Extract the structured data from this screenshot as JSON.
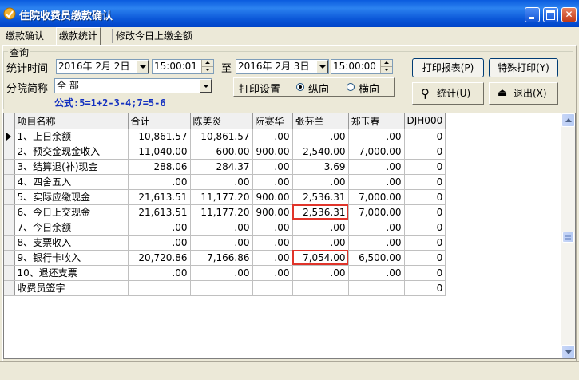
{
  "window": {
    "title": "住院收费员缴款确认"
  },
  "tabs": [
    {
      "label": "缴款确认"
    },
    {
      "label": "缴款统计"
    },
    {
      "label": "修改今日上缴金额"
    }
  ],
  "query": {
    "group_title": "查询",
    "stat_time_label": "统计时间",
    "date_from": "2016年 2月 2日",
    "time_from": "15:00:01",
    "to_label": "至",
    "date_to": "2016年 2月 3日",
    "time_to": "15:00:00",
    "branch_label": "分院简称",
    "branch_value": "全 部",
    "formula": "公式:5=1+2-3-4;7=5-6",
    "print_settings_label": "打印设置",
    "radio_vertical": "纵向",
    "radio_horizontal": "横向"
  },
  "buttons": {
    "print_report": "打印报表(P)",
    "special_print": "特殊打印(Y)",
    "stats": "统计(U)",
    "exit": "退出(X)"
  },
  "table": {
    "columns": [
      "项目名称",
      "合计",
      "陈美炎",
      "阮赛华",
      "张芬兰",
      "郑玉春",
      "DJH000"
    ],
    "rows": [
      [
        "1、上日余额",
        "10,861.57",
        "10,861.57",
        ".00",
        ".00",
        ".00",
        "0"
      ],
      [
        "2、预交金现金收入",
        "11,040.00",
        "600.00",
        "900.00",
        "2,540.00",
        "7,000.00",
        "0"
      ],
      [
        "3、结算退(补)现金",
        "288.06",
        "284.37",
        ".00",
        "3.69",
        ".00",
        "0"
      ],
      [
        "4、四舍五入",
        ".00",
        ".00",
        ".00",
        ".00",
        ".00",
        "0"
      ],
      [
        "5、实际应缴现金",
        "21,613.51",
        "11,177.20",
        "900.00",
        "2,536.31",
        "7,000.00",
        "0"
      ],
      [
        "6、今日上交现金",
        "21,613.51",
        "11,177.20",
        "900.00",
        "2,536.31",
        "7,000.00",
        "0"
      ],
      [
        "7、今日余额",
        ".00",
        ".00",
        ".00",
        ".00",
        ".00",
        "0"
      ],
      [
        "8、支票收入",
        ".00",
        ".00",
        ".00",
        ".00",
        ".00",
        "0"
      ],
      [
        "9、银行卡收入",
        "20,720.86",
        "7,166.86",
        ".00",
        "7,054.00",
        "6,500.00",
        "0"
      ],
      [
        "10、退还支票",
        ".00",
        ".00",
        ".00",
        ".00",
        ".00",
        "0"
      ],
      [
        "收费员签字",
        "",
        "",
        "",
        "",
        "",
        "0"
      ]
    ]
  }
}
